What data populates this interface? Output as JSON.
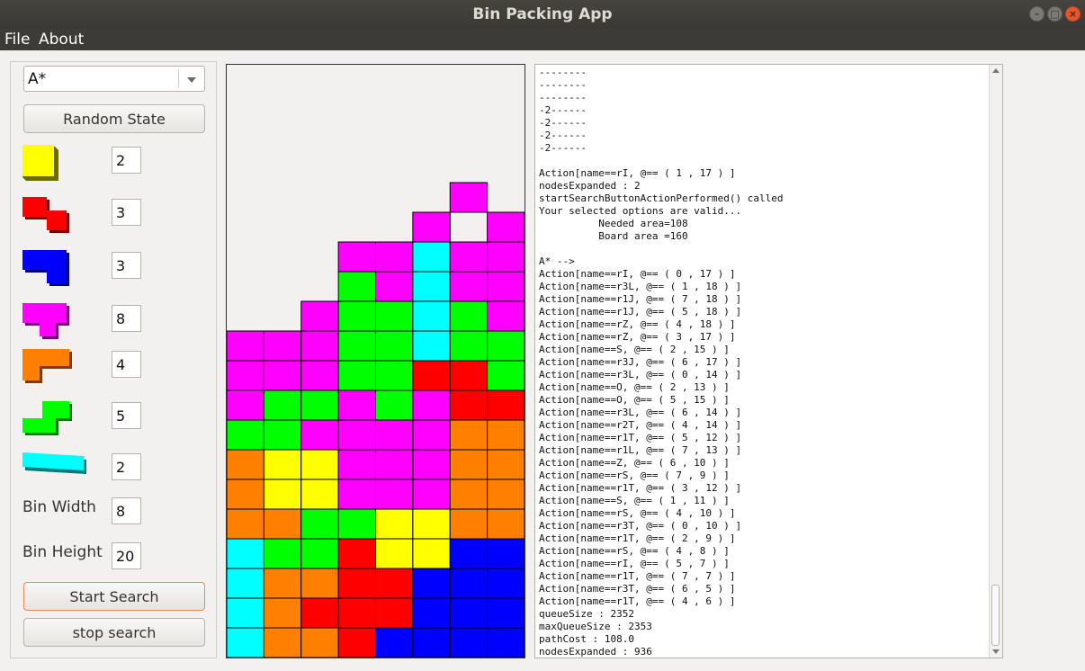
{
  "window": {
    "title": "Bin Packing App"
  },
  "menu": {
    "file": "File",
    "about": "About"
  },
  "controls": {
    "algorithm": "A*",
    "random_state": "Random State",
    "pieces": [
      {
        "name": "O",
        "color": "#ffff00",
        "count": "2"
      },
      {
        "name": "Z",
        "color": "#ff0000",
        "count": "3"
      },
      {
        "name": "J",
        "color": "#0000ff",
        "count": "3"
      },
      {
        "name": "T",
        "color": "#ff00ff",
        "count": "8"
      },
      {
        "name": "L",
        "color": "#ff7f00",
        "count": "4"
      },
      {
        "name": "S",
        "color": "#00ff00",
        "count": "5"
      },
      {
        "name": "I",
        "color": "#00ffff",
        "count": "2"
      }
    ],
    "bin_width_label": "Bin Width",
    "bin_width": "8",
    "bin_height_label": "Bin Height",
    "bin_height": "20",
    "start_search": "Start Search",
    "stop_search": "stop search"
  },
  "board": {
    "cols": 8,
    "rows": 20,
    "colors": {
      "Y": "#ffff00",
      "R": "#ff0000",
      "B": "#0000ff",
      "M": "#ff00ff",
      "O": "#ff7f00",
      "G": "#00ff00",
      "C": "#00ffff"
    },
    "grid": [
      "........",
      "........",
      "........",
      "........",
      "........",
      "........",
      "........",
      "........",
      "......M.",
      ".....M.MM",
      "...MMCMM",
      "...GMCMM",
      "..MGGCGM",
      "MMMGGCGG",
      "MMMGGRRG",
      "MGGMGMRR",
      "GGMMMMOO",
      "OYYMMMOO",
      "OYYMMMOO",
      "OOGGYYOO",
      "CGGRYYBB",
      "COORRBBB",
      "CORRRBBB",
      "COORBBBB"
    ]
  },
  "log": {
    "lines": [
      "--------",
      "--------",
      "--------",
      "-2------",
      "-2------",
      "-2------",
      "-2------",
      "",
      "Action[name==rI, @== ( 1 , 17 ) ]",
      "nodesExpanded : 2",
      "startSearchButtonActionPerformed() called",
      "Your selected options are valid...",
      "          Needed area=108",
      "          Board area =160",
      "",
      "A* -->",
      "Action[name==rI, @== ( 0 , 17 ) ]",
      "Action[name==r3L, @== ( 1 , 18 ) ]",
      "Action[name==r1J, @== ( 7 , 18 ) ]",
      "Action[name==r1J, @== ( 5 , 18 ) ]",
      "Action[name==rZ, @== ( 4 , 18 ) ]",
      "Action[name==rZ, @== ( 3 , 17 ) ]",
      "Action[name==S, @== ( 2 , 15 ) ]",
      "Action[name==r3J, @== ( 6 , 17 ) ]",
      "Action[name==r3L, @== ( 0 , 14 ) ]",
      "Action[name==O, @== ( 2 , 13 ) ]",
      "Action[name==O, @== ( 5 , 15 ) ]",
      "Action[name==r3L, @== ( 6 , 14 ) ]",
      "Action[name==r2T, @== ( 4 , 14 ) ]",
      "Action[name==r1T, @== ( 5 , 12 ) ]",
      "Action[name==r1L, @== ( 7 , 13 ) ]",
      "Action[name==Z, @== ( 6 , 10 ) ]",
      "Action[name==rS, @== ( 7 , 9 ) ]",
      "Action[name==r1T, @== ( 3 , 12 ) ]",
      "Action[name==S, @== ( 1 , 11 ) ]",
      "Action[name==rS, @== ( 4 , 10 ) ]",
      "Action[name==r3T, @== ( 0 , 10 ) ]",
      "Action[name==r1T, @== ( 2 , 9 ) ]",
      "Action[name==rS, @== ( 4 , 8 ) ]",
      "Action[name==rI, @== ( 5 , 7 ) ]",
      "Action[name==r1T, @== ( 7 , 7 ) ]",
      "Action[name==r3T, @== ( 6 , 5 ) ]",
      "Action[name==r1T, @== ( 4 , 6 ) ]",
      "queueSize : 2352",
      "maxQueueSize : 2353",
      "pathCost : 108.0",
      "nodesExpanded : 936"
    ]
  }
}
